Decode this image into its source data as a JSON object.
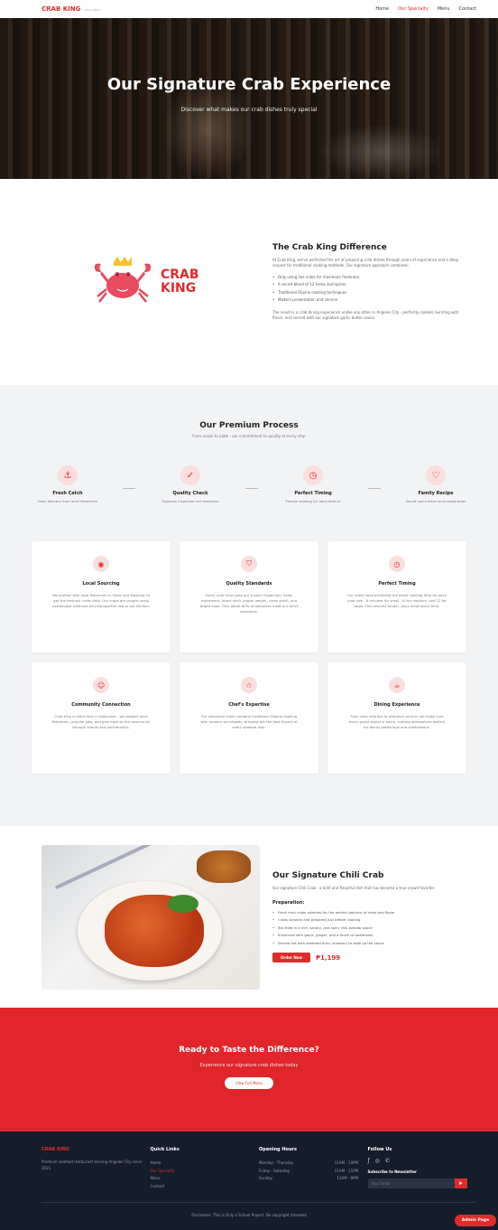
{
  "nav": {
    "logo": "CRAB KING",
    "logo_sub": "Since 2021",
    "links": [
      "Home",
      "Our Specialty",
      "Menu",
      "Contact"
    ]
  },
  "hero": {
    "title": "Our Signature Crab Experience",
    "subtitle": "Discover what makes our crab dishes truly special"
  },
  "difference": {
    "brand_line1": "CRAB",
    "brand_line2": "KING",
    "title": "The Crab King Difference",
    "intro": "At Crab King, we've perfected the art of preparing crab dishes through years of experience and a deep respect for traditional cooking methods. Our signature approach combines:",
    "points": [
      "Only using live crabs for maximum freshness",
      "A secret blend of 12 herbs and spices",
      "Traditional Filipino cooking techniques",
      "Modern presentation and service"
    ],
    "outro": "The result is a crab dining experience unlike any other in Angeles City - perfectly cooked, bursting with flavor, and served with our signature garlic butter sauce."
  },
  "process": {
    "title": "Our Premium Process",
    "subtitle": "From ocean to plate - our commitment to quality at every step",
    "steps": [
      {
        "icon": "anchor-icon",
        "title": "Fresh Catch",
        "desc": "Daily delivery from local fishermen"
      },
      {
        "icon": "check-circle-icon",
        "title": "Quality Check",
        "desc": "Rigorous inspection for freshness"
      },
      {
        "icon": "clock-icon",
        "title": "Perfect Timing",
        "desc": "Precise cooking for ideal texture"
      },
      {
        "icon": "heart-icon",
        "title": "Family Recipe",
        "desc": "Secret spice blend and preparation"
      }
    ],
    "cards": [
      {
        "icon": "map-pin-icon",
        "title": "Local Sourcing",
        "text": "We partner with local fishermen in Subic and Masinloc to get the freshest crabs daily. Our crabs are caught using sustainable methods and transported live to our kitchen."
      },
      {
        "icon": "shield-icon",
        "title": "Quality Standards",
        "text": "Every crab must pass our 5-point inspection: lively movement, intact shell, proper weight, clean smell, and bright color. Only about 80% of deliveries meet our strict standards."
      },
      {
        "icon": "clock-icon",
        "title": "Perfect Timing",
        "text": "Our chefs have perfected the exact cooking time for each crab size - 8 minutes for small, 10 for medium, and 12 for large. This ensures tender, juicy meat every time."
      },
      {
        "icon": "users-icon",
        "title": "Community Connection",
        "text": "Crab King is more than a restaurant - we support local fishermen, provide jobs, and give back to the community through events and partnerships."
      },
      {
        "icon": "star-icon",
        "title": "Chef's Expertise",
        "text": "Our seasoned chefs combine traditional Filipino cooking with modern techniques, bringing out the best flavors of every seafood dish."
      },
      {
        "icon": "coffee-icon",
        "title": "Dining Experience",
        "text": "From cozy interiors to attentive service, we make sure every guest enjoys a warm, inviting atmosphere perfect for family gatherings and celebrations."
      }
    ]
  },
  "chili": {
    "title": "Our Signature Chili Crab",
    "desc": "Our signature Chili Crab - a bold and flavorful dish that has become a true crowd favorite:",
    "prep_title": "Preparation:",
    "steps": [
      "Fresh mud crabs selected for the perfect balance of meat and flavor",
      "Crabs cleaned and prepared just before cooking",
      "Stir-fried in a rich, savory, and spicy chili-tomato sauce",
      "Enhanced with garlic, ginger, and a touch of sweetness",
      "Served hot with steamed buns (mantou) to soak up the sauce"
    ],
    "order_label": "Order Now",
    "price": "₱1,199"
  },
  "cta": {
    "title": "Ready to Taste the Difference?",
    "subtitle": "Experience our signature crab dishes today",
    "button": "View Full Menu"
  },
  "footer": {
    "brand": "CRAB KING",
    "brand_desc": "Premium seafood restaurant serving Angeles City since 2021.",
    "quick_title": "Quick Links",
    "quick_links": [
      "Home",
      "Our Specialty",
      "Menu",
      "Contact"
    ],
    "hours_title": "Opening Hours",
    "hours": [
      {
        "day": "Monday - Thursday",
        "time": "11AM - 10PM"
      },
      {
        "day": "Friday - Saturday",
        "time": "11AM - 11PM"
      },
      {
        "day": "Sunday",
        "time": "11AM - 9PM"
      }
    ],
    "follow_title": "Follow Us",
    "newsletter_label": "Subscribe to Newsletter",
    "newsletter_placeholder": "Your Email",
    "disclaimer": "Disclaimer: This is Only a School Project. No copyright intended",
    "admin_button": "Admin Page"
  },
  "colors": {
    "accent": "#e02b2b",
    "footer_bg": "#151d2b",
    "section_bg": "#f2f3f5"
  }
}
